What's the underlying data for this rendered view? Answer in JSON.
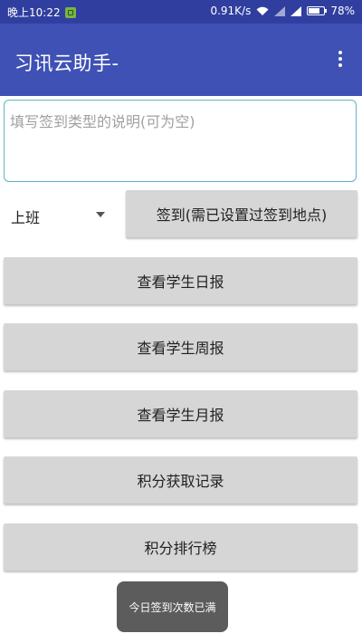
{
  "status_bar": {
    "time": "晚上10:22",
    "network_speed": "0.91K/s",
    "battery": "78%",
    "battery_level": 0.78,
    "icons": [
      "app-notification-icon",
      "wifi-icon",
      "signal-icon",
      "signal-icon",
      "battery-icon"
    ]
  },
  "app_bar": {
    "title": "习讯云助手-",
    "menu_icon": "overflow-menu-icon"
  },
  "description_field": {
    "value": "",
    "placeholder": "填写签到类型的说明(可为空)"
  },
  "check_type_spinner": {
    "selected": "上班"
  },
  "buttons": {
    "check_in": "签到(需已设置过签到地点)",
    "daily_report": "查看学生日报",
    "weekly_report": "查看学生周报",
    "monthly_report": "查看学生月报",
    "points_history": "积分获取记录",
    "points_ranking": "积分排行榜"
  },
  "toast": {
    "message": "今日签到次数已满"
  },
  "colors": {
    "status_bar": "#303f9f",
    "app_bar": "#3f51b5",
    "button": "#d6d6d6",
    "field_border": "#5fb2c9"
  }
}
